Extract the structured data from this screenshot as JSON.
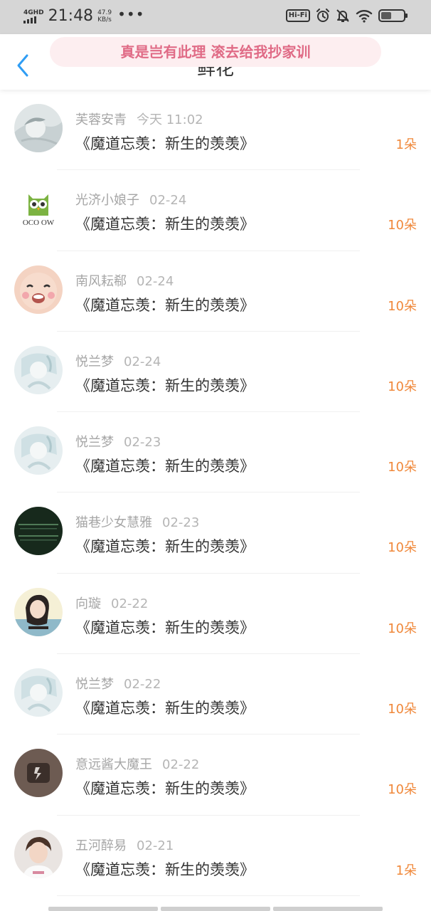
{
  "status_bar": {
    "network_type": "4GHD",
    "time": "21:48",
    "speed_value": "47.9",
    "speed_unit": "KB/s",
    "more": "•••",
    "hifi": "Hi-Fi"
  },
  "header": {
    "title": "鲜花",
    "toast": "真是岂有此理 滚去给我抄家训"
  },
  "items": [
    {
      "name": "芙蓉安青",
      "date": "今天 11:02",
      "book": "《魔道忘羡：新生的羡羡》",
      "count": "1朵",
      "avatar": "anime-sleeping-avatar"
    },
    {
      "name": "光济小娘子",
      "date": "02-24",
      "book": "《魔道忘羡：新生的羡羡》",
      "count": "10朵",
      "avatar": "owl-logo-avatar"
    },
    {
      "name": "南风耘郗",
      "date": "02-24",
      "book": "《魔道忘羡：新生的羡羡》",
      "count": "10朵",
      "avatar": "baby-face-avatar"
    },
    {
      "name": "悦兰梦",
      "date": "02-24",
      "book": "《魔道忘羡：新生的羡羡》",
      "count": "10朵",
      "avatar": "pale-anime-avatar"
    },
    {
      "name": "悦兰梦",
      "date": "02-23",
      "book": "《魔道忘羡：新生的羡羡》",
      "count": "10朵",
      "avatar": "pale-anime-avatar"
    },
    {
      "name": "猫巷少女慧雅",
      "date": "02-23",
      "book": "《魔道忘羡：新生的羡羡》",
      "count": "10朵",
      "avatar": "dark-text-avatar"
    },
    {
      "name": "向璇",
      "date": "02-22",
      "book": "《魔道忘羡：新生的羡羡》",
      "count": "10朵",
      "avatar": "girl-portrait-avatar"
    },
    {
      "name": "悦兰梦",
      "date": "02-22",
      "book": "《魔道忘羡：新生的羡羡》",
      "count": "10朵",
      "avatar": "pale-anime-avatar"
    },
    {
      "name": "意远酱大魔王",
      "date": "02-22",
      "book": "《魔道忘羡：新生的羡羡》",
      "count": "10朵",
      "avatar": "dark-brown-avatar"
    },
    {
      "name": "五河醉易",
      "date": "02-21",
      "book": "《魔道忘羡：新生的羡羡》",
      "count": "1朵",
      "avatar": "boy-portrait-avatar"
    }
  ],
  "colors": {
    "accent_count": "#f0883a",
    "back_arrow": "#2f9df4",
    "toast_text": "#e06b86"
  }
}
